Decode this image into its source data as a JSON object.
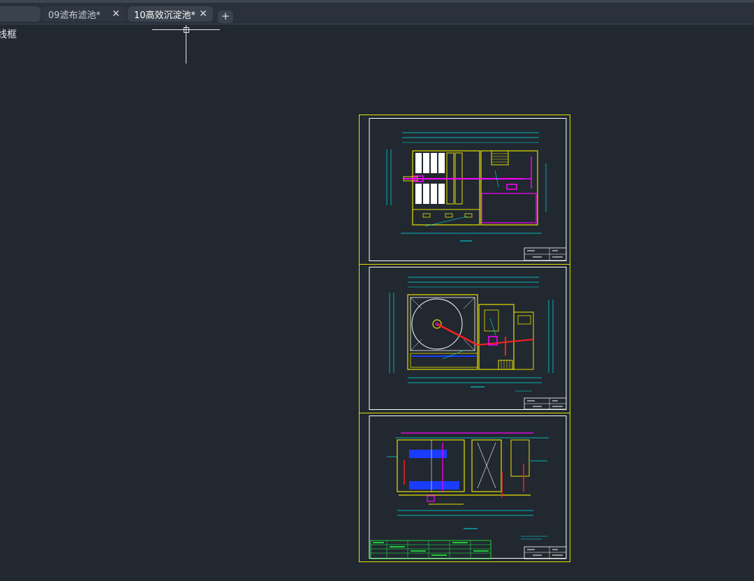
{
  "tabs": {
    "previous_partial_label": "",
    "items": [
      {
        "label": "09滤布滤池*",
        "close": "✕"
      },
      {
        "label": "10高效沉淀池*",
        "close": "✕"
      }
    ],
    "new_tab_label": "+"
  },
  "viewport": {
    "partial_label": "线框"
  },
  "colors": {
    "background": "#212830",
    "sheet_border": "#e8e000",
    "frame": "#ffffff",
    "cyan": "#00e5e5",
    "magenta": "#ff00ff",
    "red": "#ff2020",
    "blue": "#1a3cff",
    "green": "#20ff40"
  },
  "drawing_sheets": [
    "plan-upper",
    "plan-lower",
    "section"
  ]
}
